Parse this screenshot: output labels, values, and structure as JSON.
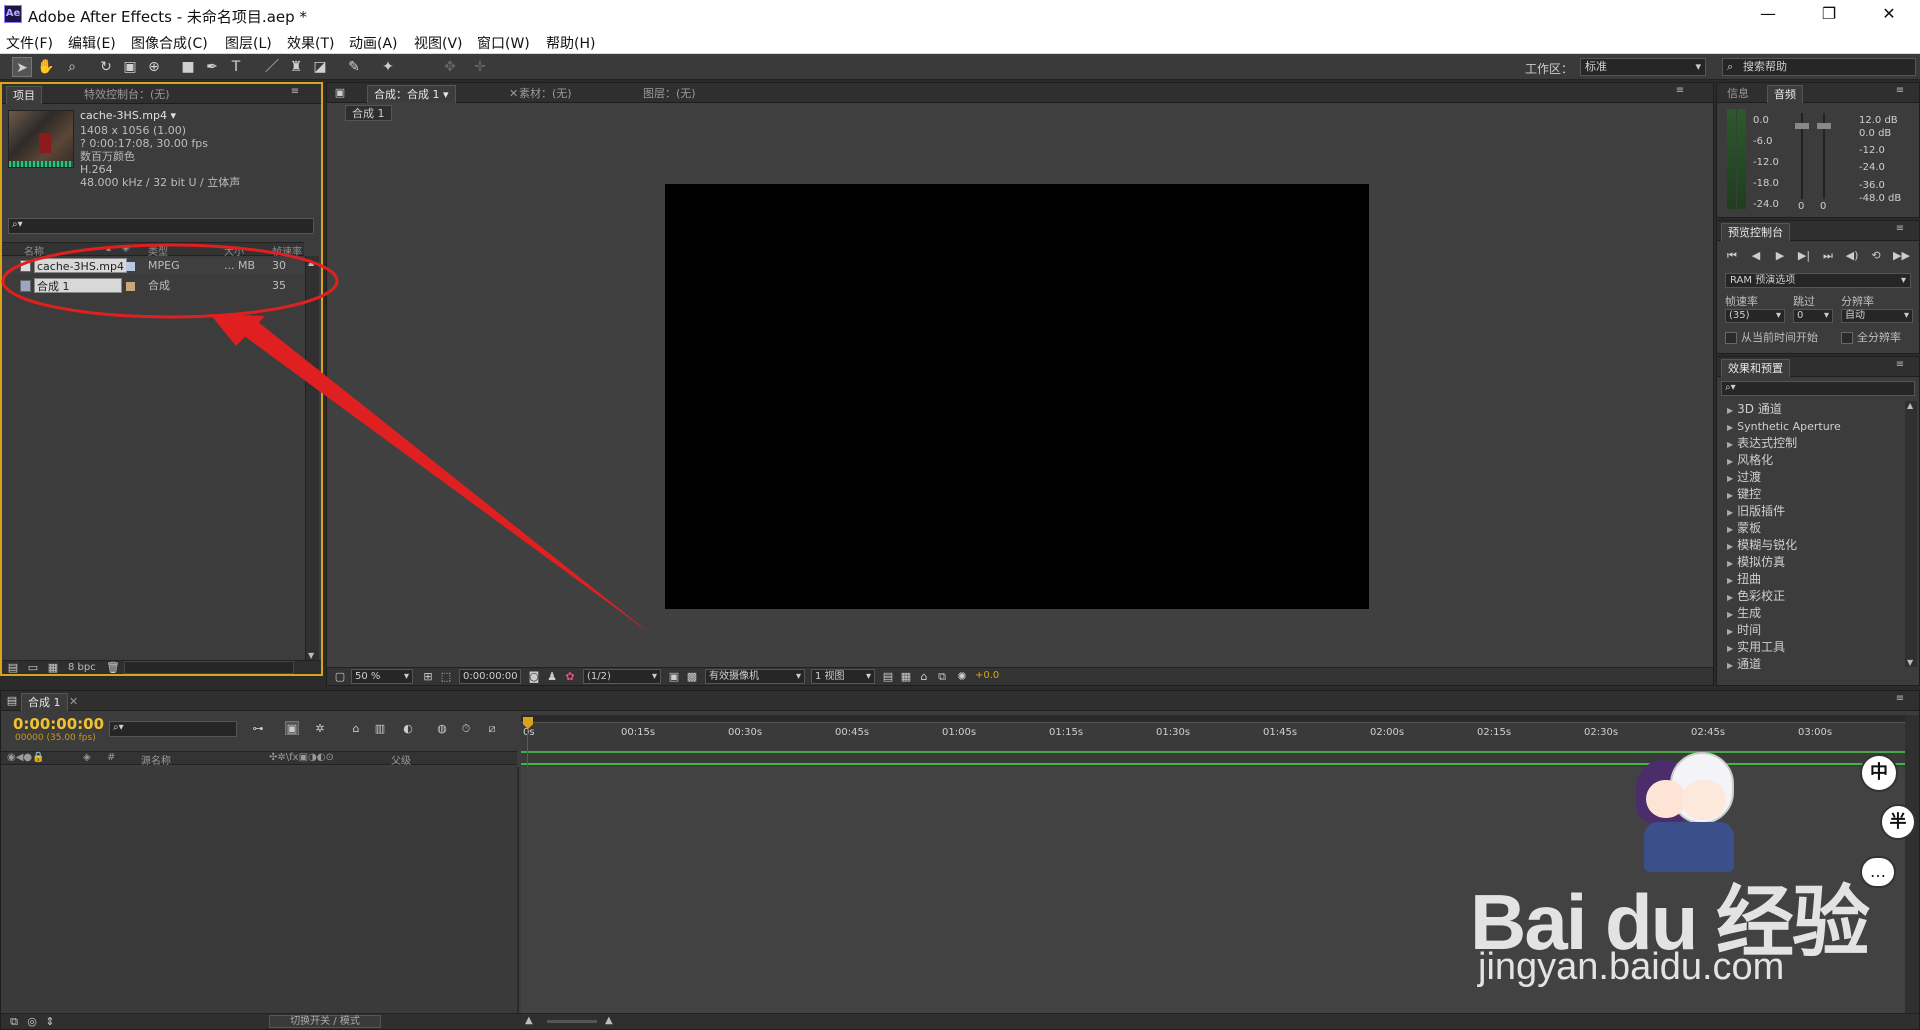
{
  "window": {
    "logo_text": "Ae",
    "title": "Adobe After Effects - 未命名项目.aep *",
    "minimize": "—",
    "maximize": "❐",
    "close": "✕"
  },
  "menu": [
    "文件(F)",
    "编辑(E)",
    "图像合成(C)",
    "图层(L)",
    "效果(T)",
    "动画(A)",
    "视图(V)",
    "窗口(W)",
    "帮助(H)"
  ],
  "toolbar": {
    "workspace_label": "工作区：",
    "workspace_value": "标准",
    "help_placeholder": "搜索帮助"
  },
  "project_panel": {
    "tabs": [
      "项目",
      "特效控制台：(无)"
    ],
    "item": {
      "name": "cache-3HS.mp4",
      "dimensions": "1408 x 1056 (1.00)",
      "duration": "? 0:00:17:08, 30.00 fps",
      "colors": "数百万颜色",
      "codec": "H.264",
      "audio": "48.000 kHz / 32 bit U / 立体声"
    },
    "search_placeholder": "",
    "columns": [
      "名称",
      "类型",
      "大小",
      "帧速率"
    ],
    "rows": [
      {
        "name": "cache-3HS.mp4",
        "type": "MPEG",
        "size": "... MB",
        "fps": "30"
      },
      {
        "name": "合成 1",
        "type": "合成",
        "size": "",
        "fps": "35"
      }
    ],
    "footer_bpc": "8 bpc"
  },
  "comp_panel": {
    "tabs": [
      "合成：合成 1",
      "素材：(无)",
      "图层：(无)"
    ],
    "breadcrumb": "合成 1",
    "bottom": {
      "zoom": "50 %",
      "timecode": "0:00:00:00",
      "resolution": "(1/2)",
      "camera": "有效摄像机",
      "views": "1 视图",
      "exposure": "+0.0"
    }
  },
  "info_panel": {
    "tabs": [
      "信息",
      "音频"
    ],
    "left_scale": [
      "0.0",
      "-6.0",
      "-12.0",
      "-18.0",
      "-24.0"
    ],
    "right_scale": [
      "12.0 dB",
      "0.0 dB",
      "-12.0",
      "-24.0",
      "-36.0",
      "-48.0 dB"
    ],
    "slider_marks": [
      "0",
      "0"
    ]
  },
  "preview_panel": {
    "tab": "预览控制台",
    "ram_options": "RAM 预演选项",
    "labels": [
      "帧速率",
      "跳过",
      "分辨率"
    ],
    "values": [
      "(35)",
      "0",
      "自动"
    ],
    "from_current": "从当前时间开始",
    "full_screen": "全分辨率"
  },
  "effects_panel": {
    "tab": "效果和预置",
    "items": [
      "3D 通道",
      "Synthetic Aperture",
      "表达式控制",
      "风格化",
      "过渡",
      "键控",
      "旧版插件",
      "蒙板",
      "模糊与锐化",
      "模拟仿真",
      "扭曲",
      "色彩校正",
      "生成",
      "时间",
      "实用工具",
      "通道"
    ]
  },
  "timeline": {
    "tab": "合成 1",
    "timecode": "0:00:00:00",
    "frames": "00000 (35.00 fps)",
    "col_source": "源名称",
    "col_parent": "父级",
    "col_hash": "#",
    "ruler": [
      "0s",
      "00:15s",
      "00:30s",
      "00:45s",
      "01:00s",
      "01:15s",
      "01:30s",
      "01:45s",
      "02:00s",
      "02:15s",
      "02:30s",
      "02:45s",
      "03:00s"
    ],
    "footer_toggle": "切换开关 / 模式"
  },
  "watermark": {
    "brand": "Bai du 经验",
    "url": "jingyan.baidu.com",
    "badges": [
      "中",
      "半"
    ]
  },
  "colors": {
    "accent_yellow": "#d9a31a",
    "annotation_red": "#e02020",
    "timecode": "#f2c230"
  }
}
